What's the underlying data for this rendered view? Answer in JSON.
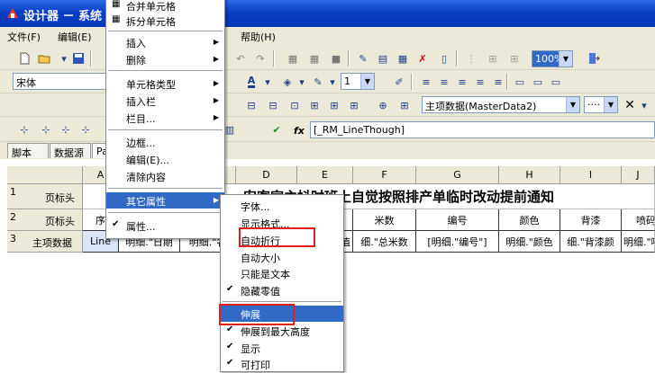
{
  "window": {
    "title": "设计器 － 系统"
  },
  "menubar": {
    "file": "文件(F)",
    "edit": "编辑(E)",
    "help": "帮助(H)"
  },
  "toolbar": {
    "font_name": "宋体",
    "zoom": "100%",
    "line_width": "1",
    "datasource": "主项数据(MasterData2)",
    "fx": "fx",
    "formula": "[_RM_LineThough]"
  },
  "tabs": [
    "脚本",
    "数据源",
    "Pa"
  ],
  "grid": {
    "columns": [
      "A",
      "D",
      "E",
      "F",
      "G",
      "H",
      "I",
      "J"
    ],
    "rows": [
      {
        "num": "1",
        "label": "页标头",
        "title": "安客家主抖时班上自觉按照排产单临时改动提前通知"
      },
      {
        "num": "2",
        "label": "页标头",
        "cells": [
          "序",
          "米数",
          "编号",
          "颜色",
          "背漆",
          "喷码"
        ]
      },
      {
        "num": "3",
        "label": "主项数据",
        "cells": [
          "Line",
          "明细.\"日期",
          "明细.\"名",
          "值",
          "细.\"总米数",
          "[明细.\"编号\"]",
          "明细.\"颜色",
          "细.\"背漆颜",
          "明细.\"喷"
        ]
      }
    ]
  },
  "context_menu": {
    "items": [
      {
        "label": "合并单元格"
      },
      {
        "label": "拆分单元格"
      },
      {
        "label": "插入",
        "submenu": true
      },
      {
        "label": "删除",
        "submenu": true
      },
      {
        "label": "单元格类型",
        "submenu": true
      },
      {
        "label": "插入栏",
        "submenu": true
      },
      {
        "label": "栏目...",
        "submenu": true
      },
      {
        "label": "边框..."
      },
      {
        "label": "编辑(E)..."
      },
      {
        "label": "清除内容"
      },
      {
        "label": "其它属性",
        "submenu": true
      },
      {
        "label": "属性..."
      }
    ]
  },
  "submenu": {
    "items": [
      {
        "label": "字体..."
      },
      {
        "label": "显示格式..."
      },
      {
        "label": "自动折行"
      },
      {
        "label": "自动大小"
      },
      {
        "label": "只能是文本"
      },
      {
        "label": "隐藏零值",
        "checked": true
      },
      {
        "label": "伸展"
      },
      {
        "label": "伸展到最大高度",
        "checked": true
      },
      {
        "label": "显示",
        "checked": true
      },
      {
        "label": "可打印",
        "checked": true
      }
    ]
  },
  "colors": {
    "titlebar": "#0a3fc4",
    "highlight": "#316ac5",
    "annotation": "#e0201e"
  }
}
